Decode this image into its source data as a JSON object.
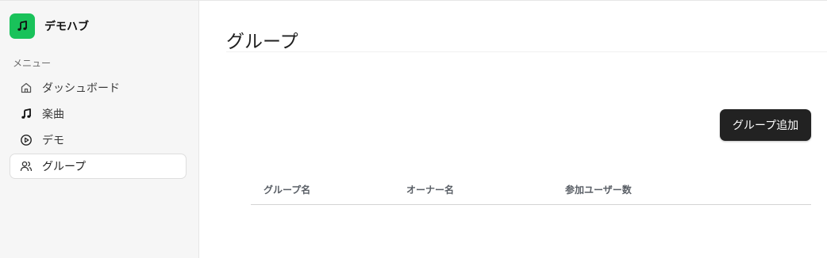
{
  "sidebar": {
    "brand": {
      "name": "デモハブ",
      "logo_icon": "music-note-icon",
      "logo_color": "#19c25a"
    },
    "menu_heading": "メニュー",
    "items": [
      {
        "label": "ダッシュボード",
        "icon": "home-icon",
        "active": false
      },
      {
        "label": "楽曲",
        "icon": "music-note-icon",
        "active": false
      },
      {
        "label": "デモ",
        "icon": "play-circle-icon",
        "active": false
      },
      {
        "label": "グループ",
        "icon": "users-icon",
        "active": true
      }
    ]
  },
  "main": {
    "title": "グループ",
    "add_button_label": "グループ追加",
    "table": {
      "columns": [
        "グループ名",
        "オーナー名",
        "参加ユーザー数"
      ],
      "rows": []
    }
  },
  "colors": {
    "accent": "#19c25a",
    "button_bg": "#222222",
    "sidebar_bg": "#f6f6f6"
  }
}
